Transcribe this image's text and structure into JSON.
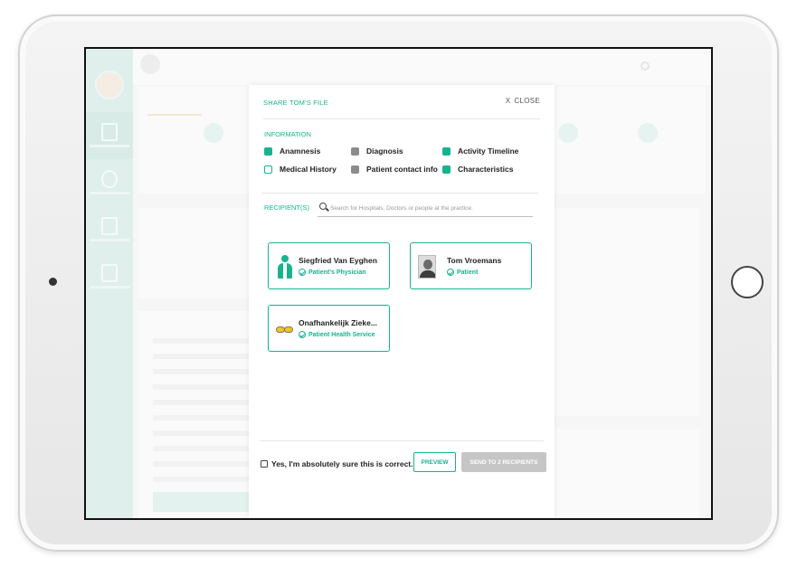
{
  "modal": {
    "title": "SHARE TOM'S FILE",
    "close_glyph": "X",
    "close_label": "CLOSE"
  },
  "information": {
    "label": "INFORMATION",
    "items": [
      {
        "label": "Anamnesis",
        "state": "checked-teal"
      },
      {
        "label": "Diagnosis",
        "state": "checked-gray"
      },
      {
        "label": "Activity Timeline",
        "state": "checked-teal"
      },
      {
        "label": "Medical History",
        "state": "unchecked"
      },
      {
        "label": "Patient contact info",
        "state": "checked-gray"
      },
      {
        "label": "Characteristics",
        "state": "checked-teal"
      }
    ]
  },
  "recipients": {
    "label": "RECIPIENT(S)",
    "search_placeholder": "Search for Hospitals, Doctors or people at the practice.",
    "cards": [
      {
        "name": "Siegfried Van Eyghen",
        "role": "Patient's Physician",
        "icon": "doctor-icon"
      },
      {
        "name": "Tom Vroemans",
        "role": "Patient",
        "icon": "person-photo-icon"
      },
      {
        "name": "Onafhankelijk Zieke...",
        "role": "Patient Health Service",
        "icon": "health-service-logo-icon"
      }
    ]
  },
  "footer": {
    "confirm_label": "Yes, I'm absolutely sure this is correct.",
    "preview_label": "PREVIEW",
    "send_label": "SEND TO 2 RECIPIENTS"
  },
  "colors": {
    "accent": "#17b38f",
    "checked_gray": "#8c8c8c",
    "send_disabled": "#c6c6c6"
  }
}
